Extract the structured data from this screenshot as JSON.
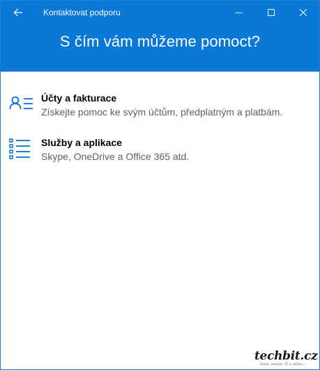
{
  "window": {
    "title": "Kontaktovat podporu",
    "accent_color": "#0a78d7"
  },
  "titlebar": {
    "back_icon": "back-arrow-icon",
    "minimize_icon": "minimize-icon",
    "maximize_icon": "maximize-icon",
    "close_icon": "close-icon"
  },
  "header": {
    "heading": "S čím vám můžeme pomoct?"
  },
  "options": [
    {
      "icon": "person-list-icon",
      "title": "Účty a fakturace",
      "description": "Získejte pomoc ke svým účtům, předplatným a platbám."
    },
    {
      "icon": "bulleted-list-icon",
      "title": "Služby a aplikace",
      "description": "Skype, OneDrive a Office 365 atd."
    }
  ],
  "watermark": {
    "text": "techbit.cz",
    "tagline": "život, vesmír, IT a vůbec..."
  }
}
